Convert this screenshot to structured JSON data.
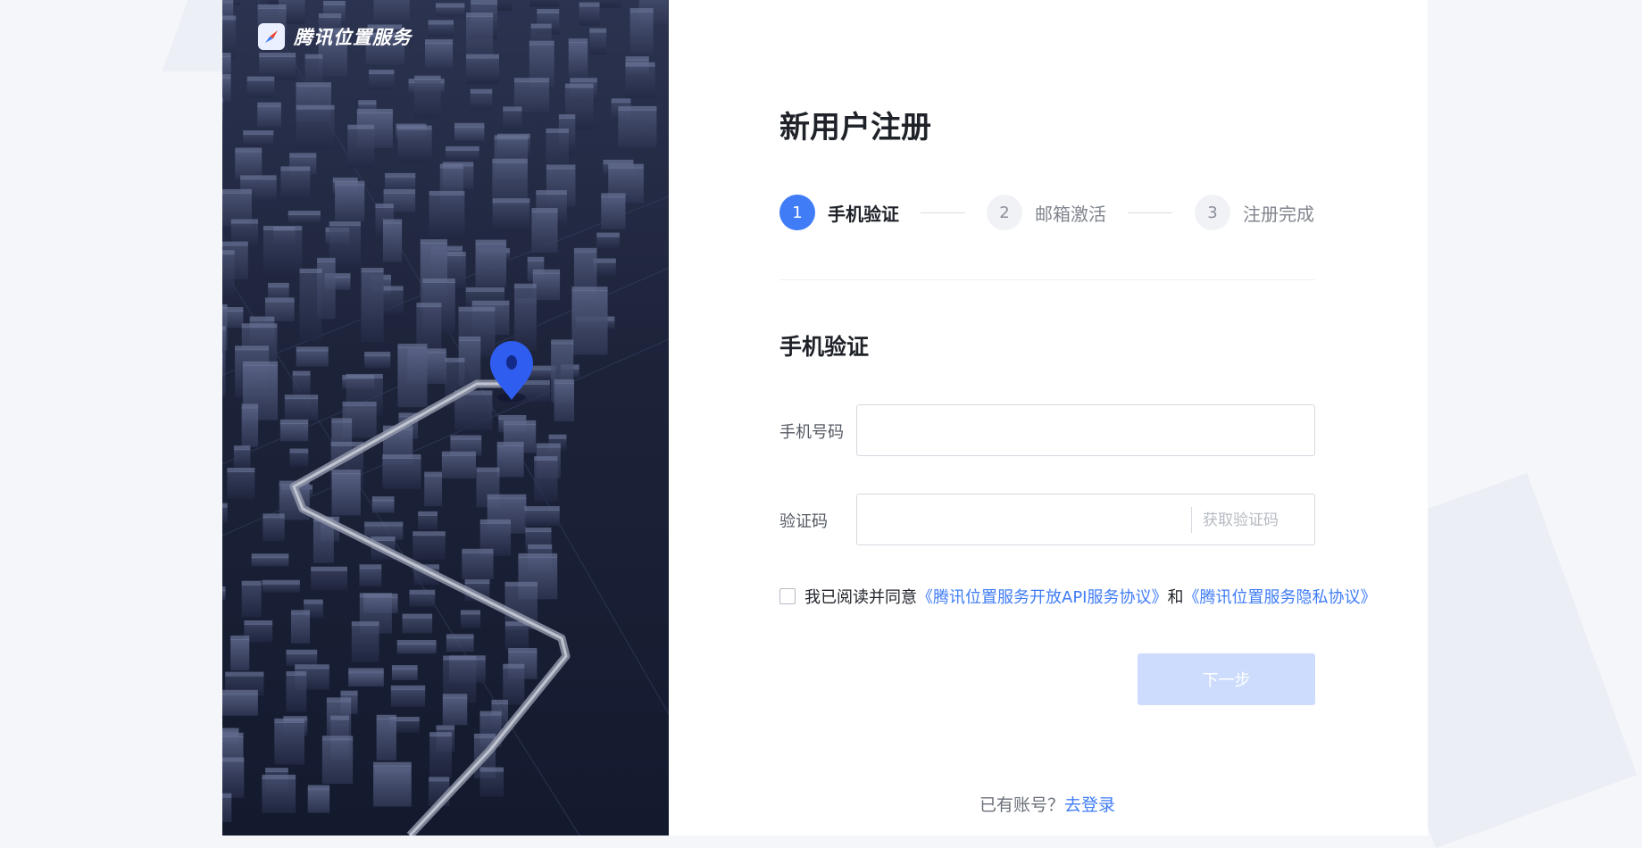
{
  "brand": {
    "name": "腾讯位置服务"
  },
  "register": {
    "title": "新用户注册",
    "steps": [
      {
        "number": "1",
        "label": "手机验证",
        "state": "active"
      },
      {
        "number": "2",
        "label": "邮箱激活",
        "state": "inactive"
      },
      {
        "number": "3",
        "label": "注册完成",
        "state": "inactive"
      }
    ],
    "section_title": "手机验证"
  },
  "form": {
    "phone_label": "手机号码",
    "phone_value": "",
    "code_label": "验证码",
    "code_value": "",
    "get_code": "获取验证码",
    "agree_prefix": "我已阅读并同意",
    "agree_link1": "《腾讯位置服务开放API服务协议》",
    "agree_and": "和",
    "agree_link2": "《腾讯位置服务隐私协议》",
    "agree_checked": false,
    "next_button": "下一步"
  },
  "footer": {
    "prompt": "已有账号？",
    "login_link": "去登录"
  },
  "colors": {
    "accent": "#3f7cf6",
    "disabled_button": "#cddcfd",
    "panel_dark": "#1c2238",
    "pin": "#2f5df0"
  }
}
